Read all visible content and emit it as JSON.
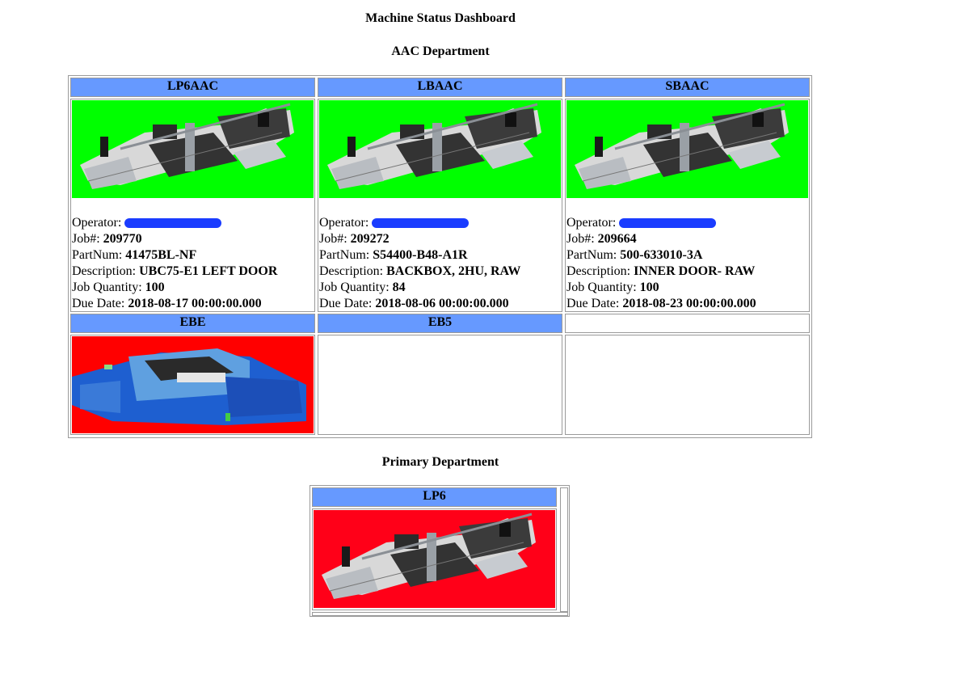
{
  "page": {
    "title": "Machine Status Dashboard"
  },
  "departments": [
    {
      "name": "AAC Department",
      "machines": [
        {
          "name": "LP6AAC",
          "status_color": "#00ff00",
          "image": "punch-laser-line",
          "operator_label": "Operator:",
          "operator_value": "[redacted]",
          "job_label": "Job#:",
          "job_value": "209770",
          "part_label": "PartNum:",
          "part_value": "41475BL-NF",
          "desc_label": "Description:",
          "desc_value": "UBC75-E1 LEFT DOOR",
          "qty_label": "Job Quantity:",
          "qty_value": "100",
          "due_label": "Due Date:",
          "due_value": "2018-08-17 00:00:00.000"
        },
        {
          "name": "LBAAC",
          "status_color": "#00ff00",
          "image": "punch-laser-line",
          "operator_label": "Operator:",
          "operator_value": "[redacted]",
          "job_label": "Job#:",
          "job_value": "209272",
          "part_label": "PartNum:",
          "part_value": "S54400-B48-A1R",
          "desc_label": "Description:",
          "desc_value": "BACKBOX, 2HU, RAW",
          "qty_label": "Job Quantity:",
          "qty_value": "84",
          "due_label": "Due Date:",
          "due_value": "2018-08-06 00:00:00.000"
        },
        {
          "name": "SBAAC",
          "status_color": "#00ff00",
          "image": "punch-laser-line",
          "operator_label": "Operator:",
          "operator_value": "[redacted]",
          "job_label": "Job#:",
          "job_value": "209664",
          "part_label": "PartNum:",
          "part_value": "500-633010-3A",
          "desc_label": "Description:",
          "desc_value": "INNER DOOR- RAW",
          "qty_label": "Job Quantity:",
          "qty_value": "100",
          "due_label": "Due Date:",
          "due_value": "2018-08-23 00:00:00.000"
        },
        {
          "name": "EBE",
          "status_color": "#ff0000",
          "image": "press-brake-cell"
        },
        {
          "name": "EB5"
        }
      ]
    },
    {
      "name": "Primary Department",
      "machines": [
        {
          "name": "LP6",
          "status_color": "#ff0018",
          "image": "punch-laser-line"
        }
      ]
    }
  ]
}
